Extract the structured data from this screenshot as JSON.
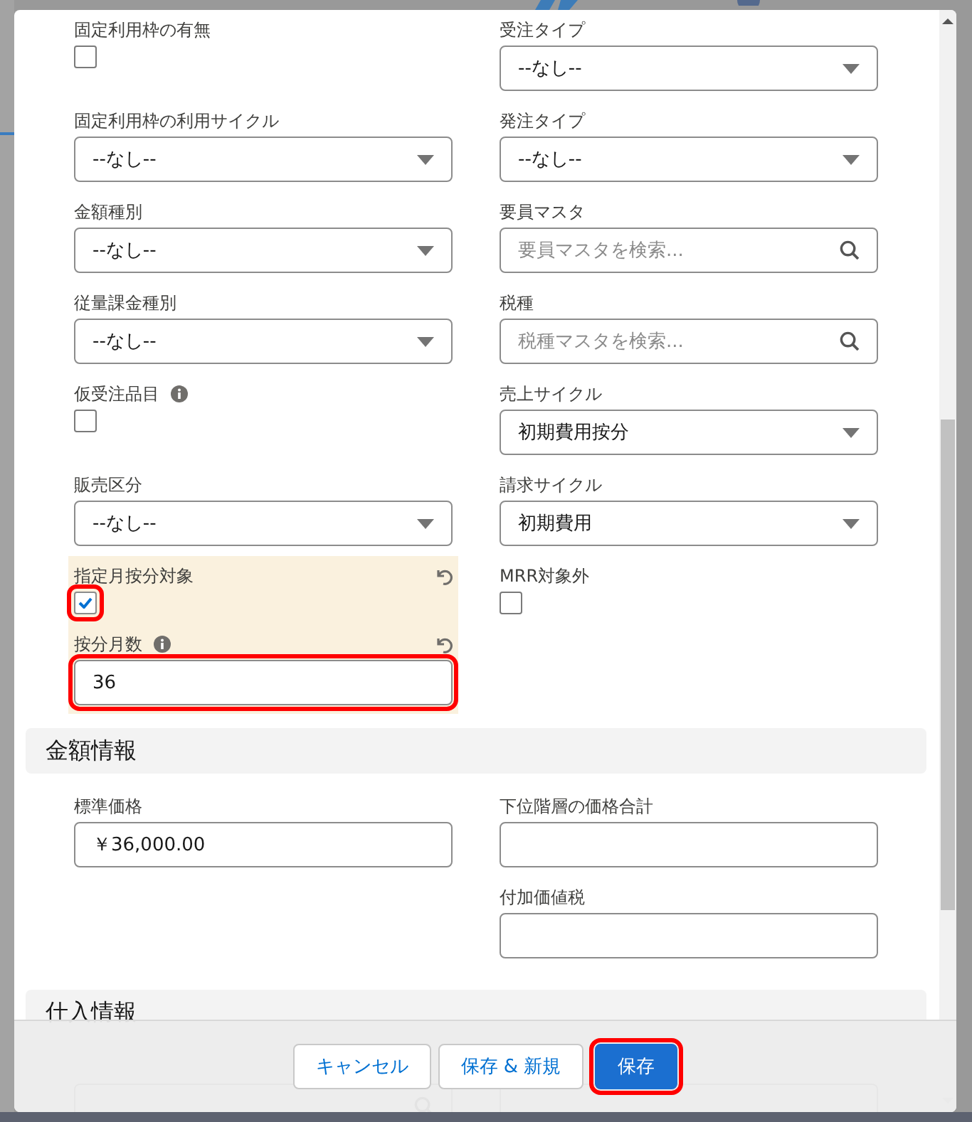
{
  "modal": {
    "sections": [
      {
        "rows": [
          {
            "left": [
              {
                "label": "固定利用枠の有無",
                "kind": "checkbox",
                "checked": false
              }
            ],
            "right": [
              {
                "label": "受注タイプ",
                "kind": "select",
                "value": "--なし--"
              }
            ]
          },
          {
            "left": [
              {
                "label": "固定利用枠の利用サイクル",
                "kind": "select",
                "value": "--なし--"
              }
            ],
            "right": [
              {
                "label": "発注タイプ",
                "kind": "select",
                "value": "--なし--"
              }
            ]
          },
          {
            "left": [
              {
                "label": "金額種別",
                "kind": "select",
                "value": "--なし--"
              }
            ],
            "right": [
              {
                "label": "要員マスタ",
                "kind": "lookup",
                "placeholder": "要員マスタを検索..."
              }
            ]
          },
          {
            "left": [
              {
                "label": "従量課金種別",
                "kind": "select",
                "value": "--なし--"
              }
            ],
            "right": [
              {
                "label": "税種",
                "kind": "lookup",
                "placeholder": "税種マスタを検索..."
              }
            ]
          },
          {
            "left": [
              {
                "label": "仮受注品目",
                "kind": "checkbox",
                "checked": false,
                "info": true
              }
            ],
            "right": [
              {
                "label": "売上サイクル",
                "kind": "select",
                "value": "初期費用按分"
              }
            ]
          },
          {
            "left": [
              {
                "label": "販売区分",
                "kind": "select",
                "value": "--なし--"
              }
            ],
            "right": [
              {
                "label": "請求サイクル",
                "kind": "select",
                "value": "初期費用"
              }
            ]
          },
          {
            "left": [
              {
                "label": "指定月按分対象",
                "kind": "checkbox",
                "checked": true,
                "edited": true,
                "annotated": true
              },
              {
                "label": "按分月数",
                "kind": "text",
                "value": "36",
                "info": true,
                "edited": true,
                "annotated": true
              }
            ],
            "right": [
              {
                "label": "MRR対象外",
                "kind": "checkbox",
                "checked": false
              }
            ]
          }
        ]
      },
      {
        "title": "金額情報",
        "rows": [
          {
            "left": [
              {
                "label": "標準価格",
                "kind": "text",
                "value": "￥36,000.00"
              }
            ],
            "right": [
              {
                "label": "下位階層の価格合計",
                "kind": "text"
              }
            ]
          },
          {
            "left": [],
            "right": [
              {
                "label": "付加価値税",
                "kind": "text"
              }
            ]
          }
        ]
      },
      {
        "title": "仕入情報",
        "rows": [
          {
            "left": [
              {
                "kind": "lookup"
              }
            ],
            "right": [
              {
                "kind": "text"
              }
            ]
          }
        ]
      }
    ],
    "buttons": [
      {
        "label": "キャンセル",
        "kind": "neutral",
        "annotated": false
      },
      {
        "label": "保存 & 新規",
        "kind": "neutral",
        "annotated": false
      },
      {
        "label": "保存",
        "kind": "brand",
        "annotated": true
      }
    ]
  }
}
